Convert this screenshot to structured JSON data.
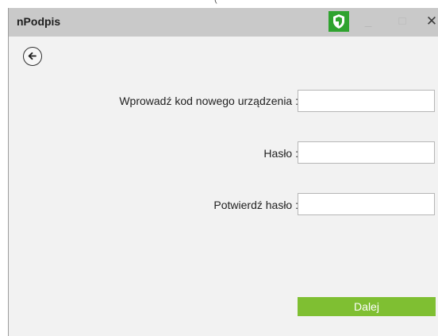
{
  "top_hint": "(",
  "app": {
    "title": "nPodpis"
  },
  "window_controls": {
    "minimize": "_",
    "maximize": "□",
    "close": "✕"
  },
  "icons": {
    "shield": "shield-icon",
    "back": "arrow-left-icon"
  },
  "colors": {
    "shield_bg": "#2fa32f",
    "next_button_bg": "#7fbf32",
    "titlebar_bg": "#c9c9c9"
  },
  "form": {
    "device_code_label": "Wprowadź kod nowego urządzenia :",
    "device_code_value": "",
    "password_label": "Hasło :",
    "password_value": "",
    "confirm_password_label": "Potwierdź hasło :",
    "confirm_password_value": "",
    "next_label": "Dalej"
  }
}
